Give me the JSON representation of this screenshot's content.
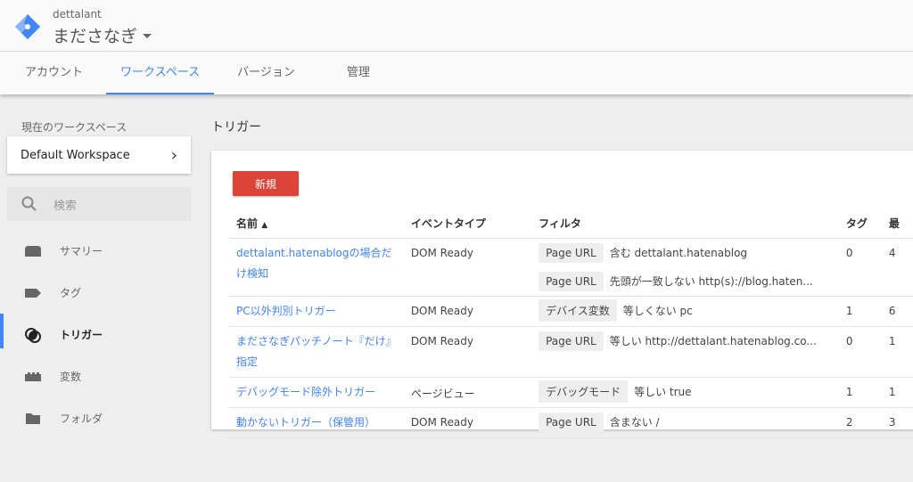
{
  "header": {
    "account": "dettalant",
    "container": "まださなぎ"
  },
  "tabs": [
    "アカウント",
    "ワークスペース",
    "バージョン",
    "管理"
  ],
  "sidebar": {
    "workspace_label": "現在のワークスペース",
    "workspace": "Default Workspace",
    "search_placeholder": "検索",
    "items": [
      {
        "label": "サマリー",
        "icon": "summary-icon"
      },
      {
        "label": "タグ",
        "icon": "tag-icon"
      },
      {
        "label": "トリガー",
        "icon": "trigger-icon",
        "active": true
      },
      {
        "label": "変数",
        "icon": "variable-icon"
      },
      {
        "label": "フォルダ",
        "icon": "folder-icon"
      }
    ]
  },
  "main": {
    "title": "トリガー",
    "new_button": "新規",
    "columns": [
      "名前",
      "イベントタイプ",
      "フィルタ",
      "タグ",
      "最"
    ],
    "rows": [
      {
        "name": "dettalant.hatenablogの場合だけ検知",
        "event": "DOM Ready",
        "filters": [
          {
            "var": "Page URL",
            "cond": "含む dettalant.hatenablog"
          },
          {
            "var": "Page URL",
            "cond": "先頭が一致しない http(s)://blog.haten..."
          }
        ],
        "tags": "0",
        "last": "4"
      },
      {
        "name": "PC以外判別トリガー",
        "event": "DOM Ready",
        "filters": [
          {
            "var": "デバイス変数",
            "cond": "等しくない pc"
          }
        ],
        "tags": "1",
        "last": "6"
      },
      {
        "name": "まださなぎパッチノート『だけ』指定",
        "event": "DOM Ready",
        "filters": [
          {
            "var": "Page URL",
            "cond": "等しい http://dettalant.hatenablog.co..."
          }
        ],
        "tags": "0",
        "last": "1"
      },
      {
        "name": "デバッグモード除外トリガー",
        "event": "ページビュー",
        "filters": [
          {
            "var": "デバッグモード",
            "cond": "等しい true"
          }
        ],
        "tags": "1",
        "last": "1"
      },
      {
        "name": "動かないトリガー（保管用）",
        "event": "DOM Ready",
        "filters": [
          {
            "var": "Page URL",
            "cond": "含まない /"
          }
        ],
        "tags": "2",
        "last": "3"
      }
    ]
  },
  "colors": {
    "accent": "#4285f4",
    "new_button": "#db4437"
  }
}
